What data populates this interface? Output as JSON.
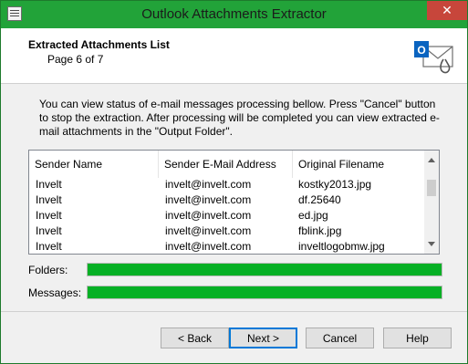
{
  "window": {
    "title": "Outlook Attachments Extractor",
    "close_glyph": "✕"
  },
  "header": {
    "title": "Extracted Attachments List",
    "subtitle": "Page 6 of 7"
  },
  "description": "You can view status of e-mail messages processing bellow. Press \"Cancel\" button to stop the extraction. After processing will be completed you can view extracted e-mail attachments in the \"Output Folder\".",
  "list": {
    "columns": [
      "Sender Name",
      "Sender E-Mail Address",
      "Original Filename"
    ],
    "rows": [
      [
        "Invelt",
        "invelt@invelt.com",
        "kostky2013.jpg"
      ],
      [
        "Invelt",
        "invelt@invelt.com",
        "df.25640"
      ],
      [
        "Invelt",
        "invelt@invelt.com",
        "ed.jpg"
      ],
      [
        "Invelt",
        "invelt@invelt.com",
        "fblink.jpg"
      ],
      [
        "Invelt",
        "invelt@invelt.com",
        "inveltlogobmw.jpg"
      ]
    ]
  },
  "progress": {
    "folders_label": "Folders:",
    "folders_percent": 100,
    "messages_label": "Messages:",
    "messages_percent": 100,
    "bar_color": "#06b025"
  },
  "buttons": {
    "back": "< Back",
    "next": "Next >",
    "cancel": "Cancel",
    "help": "Help"
  },
  "colors": {
    "titlebar": "#22a339",
    "close": "#c7463b"
  }
}
